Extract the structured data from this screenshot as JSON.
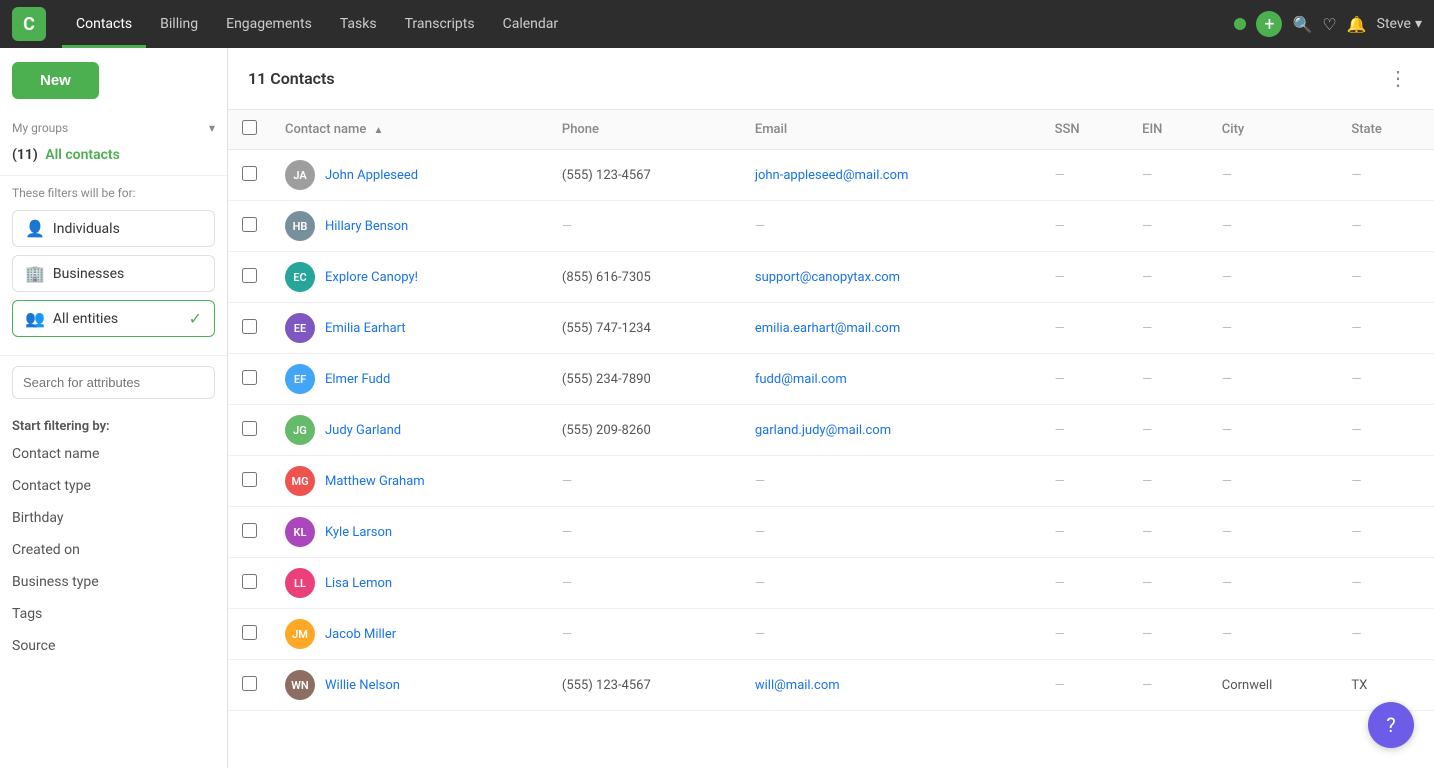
{
  "app": {
    "logo": "C",
    "nav_links": [
      "Contacts",
      "Billing",
      "Engagements",
      "Tasks",
      "Transcripts",
      "Calendar"
    ],
    "active_nav": "Contacts",
    "user": "Steve"
  },
  "sidebar": {
    "new_button": "New",
    "groups_label": "My groups",
    "all_contacts_count": "(11)",
    "all_contacts_label": "All contacts",
    "filter_label": "These filters will be for:",
    "filters": [
      {
        "id": "individuals",
        "label": "Individuals",
        "icon": "👤",
        "active": false
      },
      {
        "id": "businesses",
        "label": "Businesses",
        "icon": "🏢",
        "active": false
      },
      {
        "id": "all-entities",
        "label": "All entities",
        "icon": "👥",
        "active": true
      }
    ],
    "search_placeholder": "Search for attributes",
    "start_filtering_label": "Start filtering by:",
    "filter_attributes": [
      "Contact name",
      "Contact type",
      "Birthday",
      "Created on",
      "Business type",
      "Tags",
      "Source"
    ]
  },
  "main": {
    "contacts_count_label": "11 Contacts",
    "table": {
      "columns": [
        "Contact name",
        "Phone",
        "Email",
        "SSN",
        "EIN",
        "City",
        "State"
      ],
      "rows": [
        {
          "id": "john-appleseed",
          "initials": "JA",
          "avatar_color": "#9e9e9e",
          "name": "John Appleseed",
          "phone": "(555) 123-4567",
          "email": "john-appleseed@mail.com",
          "ssn": "—",
          "ein": "—",
          "city": "—",
          "state": "—"
        },
        {
          "id": "hillary-benson",
          "initials": "HB",
          "avatar_color": "#78909c",
          "name": "Hillary Benson",
          "phone": "—",
          "email": "—",
          "ssn": "—",
          "ein": "—",
          "city": "—",
          "state": "—"
        },
        {
          "id": "explore-canopy",
          "initials": "EC",
          "avatar_color": "#26a69a",
          "name": "Explore Canopy!",
          "phone": "(855) 616-7305",
          "email": "support@canopytax.com",
          "ssn": "—",
          "ein": "—",
          "city": "—",
          "state": "—"
        },
        {
          "id": "emilia-earhart",
          "initials": "EE",
          "avatar_color": "#7e57c2",
          "name": "Emilia Earhart",
          "phone": "(555) 747-1234",
          "email": "emilia.earhart@mail.com",
          "ssn": "—",
          "ein": "—",
          "city": "—",
          "state": "—"
        },
        {
          "id": "elmer-fudd",
          "initials": "EF",
          "avatar_color": "#42a5f5",
          "name": "Elmer Fudd",
          "phone": "(555) 234-7890",
          "email": "fudd@mail.com",
          "ssn": "—",
          "ein": "—",
          "city": "—",
          "state": "—"
        },
        {
          "id": "judy-garland",
          "initials": "JG",
          "avatar_color": "#66bb6a",
          "name": "Judy Garland",
          "phone": "(555) 209-8260",
          "email": "garland.judy@mail.com",
          "ssn": "—",
          "ein": "—",
          "city": "—",
          "state": "—"
        },
        {
          "id": "matthew-graham",
          "initials": "MG",
          "avatar_color": "#ef5350",
          "name": "Matthew Graham",
          "phone": "—",
          "email": "—",
          "ssn": "—",
          "ein": "—",
          "city": "—",
          "state": "—"
        },
        {
          "id": "kyle-larson",
          "initials": "KL",
          "avatar_color": "#ab47bc",
          "name": "Kyle Larson",
          "phone": "—",
          "email": "—",
          "ssn": "—",
          "ein": "—",
          "city": "—",
          "state": "—"
        },
        {
          "id": "lisa-lemon",
          "initials": "LL",
          "avatar_color": "#ec407a",
          "name": "Lisa Lemon",
          "phone": "—",
          "email": "—",
          "ssn": "—",
          "ein": "—",
          "city": "—",
          "state": "—"
        },
        {
          "id": "jacob-miller",
          "initials": "JM",
          "avatar_color": "#ffa726",
          "name": "Jacob Miller",
          "phone": "—",
          "email": "—",
          "ssn": "—",
          "ein": "—",
          "city": "—",
          "state": "—"
        },
        {
          "id": "willie-nelson",
          "initials": "WN",
          "avatar_color": "#8d6e63",
          "name": "Willie Nelson",
          "phone": "(555) 123-4567",
          "email": "will@mail.com",
          "ssn": "—",
          "ein": "—",
          "city": "Cornwell",
          "state": "TX"
        }
      ]
    }
  }
}
